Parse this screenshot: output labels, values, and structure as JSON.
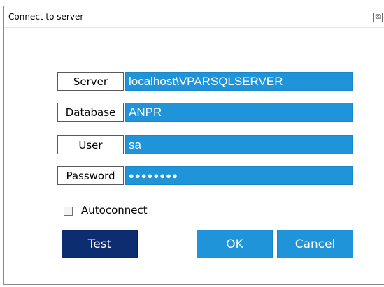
{
  "window": {
    "title": "Connect to server",
    "close_glyph": "☒"
  },
  "fields": {
    "server": {
      "label": "Server",
      "value": "localhost\\VPARSQLSERVER"
    },
    "database": {
      "label": "Database",
      "value": "ANPR"
    },
    "user": {
      "label": "User",
      "value": "sa"
    },
    "password": {
      "label": "Password",
      "value": "●●●●●●●●"
    }
  },
  "autoconnect": {
    "label": "Autoconnect",
    "checked": false
  },
  "buttons": {
    "test": "Test",
    "ok": "OK",
    "cancel": "Cancel"
  },
  "colors": {
    "field_bg": "#1f94d9",
    "test_bg": "#0c2d6f"
  }
}
